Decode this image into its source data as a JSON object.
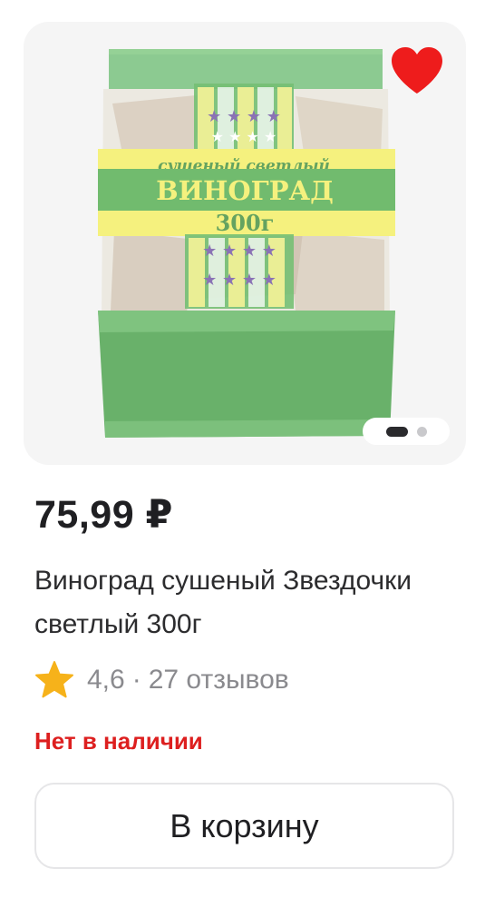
{
  "product": {
    "price": "75,99 ₽",
    "title": "Виноград сушеный Звездочки светлый 300г",
    "rating": "4,6",
    "rating_separator": "·",
    "reviews": "27 отзывов",
    "stock_status": "Нет в наличии",
    "cart_button_label": "В корзину"
  },
  "package_label": {
    "subtitle": "сушеный светлый",
    "name": "ВИНОГРАД",
    "weight": "300г"
  },
  "gallery": {
    "total_images": 2,
    "active_index": 0
  },
  "icons": {
    "favorite": "heart-icon",
    "rating": "star-icon"
  },
  "colors": {
    "favorite_heart": "#ee1c1c",
    "star": "#f6b21a",
    "stock_status": "#dd1f1f",
    "package_green": "#3fa23c",
    "package_yellow": "#f3ee5a"
  }
}
